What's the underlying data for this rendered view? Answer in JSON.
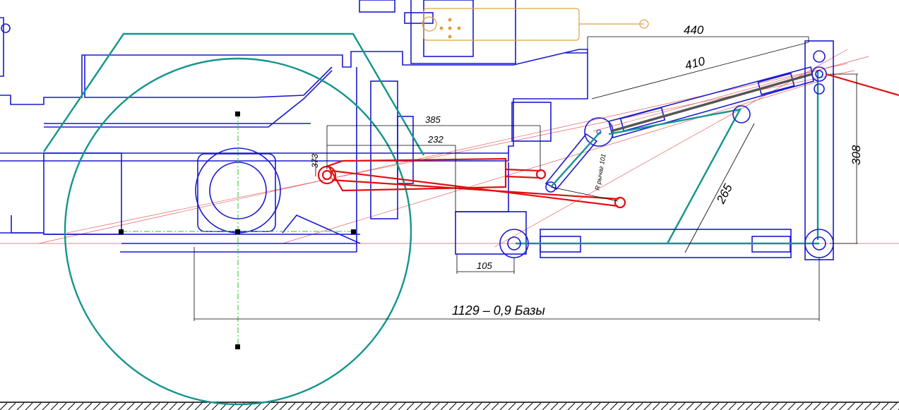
{
  "dimensions": {
    "d440": "440",
    "d410": "410",
    "d385": "385",
    "d232": "232",
    "d373": "373",
    "d308": "308",
    "d265": "265",
    "d105": "105",
    "base": "1129 –  0,9 Базы",
    "lever": "R рычаг 101"
  },
  "colors": {
    "outline": "#1a1ad0",
    "linkage": "#13958e",
    "cylinder": "#e01010",
    "hitch": "#e0a040",
    "dimension": "#000000"
  }
}
